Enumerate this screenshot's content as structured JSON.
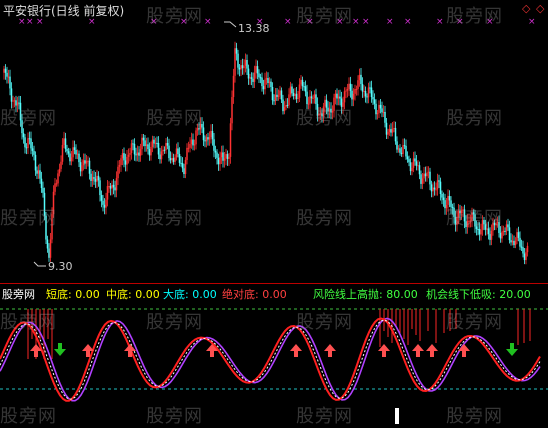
{
  "header": {
    "title": "平安银行(日线 前复权)",
    "diamond_icons": [
      "diamond-icon-red",
      "diamond-icon-red"
    ]
  },
  "price_labels": {
    "high": "13.38",
    "low": "9.30"
  },
  "indicator_legend": {
    "source": "股旁网",
    "short_bottom": "短底: 0.00",
    "mid_bottom": "中底: 0.00",
    "big_bottom": "大底: 0.00",
    "absolute_bottom": "绝对底: 0.00",
    "risk_line": "风险线上高抛: 80.00",
    "opportunity_line": "机会线下低吸: 20.00"
  },
  "watermark": "股旁网",
  "colors": {
    "up_candle": "#ff3232",
    "down_candle": "#54fcfc",
    "legend_white": "#ffffff",
    "legend_yellow": "#ffff00",
    "legend_cyan": "#00ffff",
    "legend_red": "#ff4040",
    "legend_green": "#40ff40",
    "line_k": "#ff2020",
    "line_d": "#b040ff",
    "line_dash": "#ffffff",
    "risk_dash": "#40c040",
    "opp_dash": "#20c0c0",
    "arrow_up": "#ff5050",
    "arrow_down": "#20c020"
  }
}
